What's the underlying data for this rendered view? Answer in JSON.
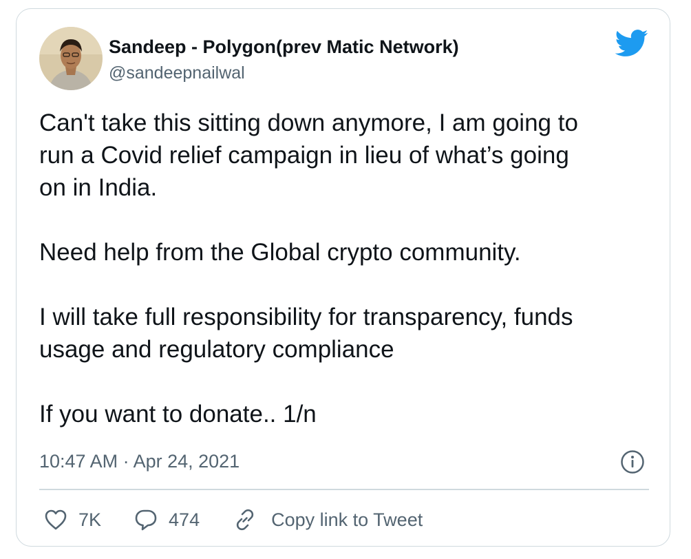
{
  "tweet": {
    "author_name": "Sandeep - Polygon(prev Matic Network)",
    "author_handle": "@sandeepnailwal",
    "paragraphs": [
      "Can't take this sitting down anymore, I am going to\nrun a Covid relief campaign in lieu of what’s going\non in India.",
      "Need help from the Global crypto community.",
      "I will take full responsibility for transparency, funds\nusage and regulatory compliance",
      "If you want to donate.. 1/n"
    ],
    "timestamp": "10:47 AM · Apr 24, 2021"
  },
  "actions": {
    "likes": "7K",
    "replies": "474",
    "copy_link_label": "Copy link to Tweet"
  },
  "icons": {
    "brand": "twitter-bird-icon",
    "info": "info-icon",
    "like": "heart-icon",
    "reply": "speech-bubble-icon",
    "copy_link": "link-icon"
  },
  "colors": {
    "twitter_blue": "#1d9bf0",
    "text": "#0f1419",
    "secondary_text": "#536471",
    "border": "#cfd9de"
  }
}
